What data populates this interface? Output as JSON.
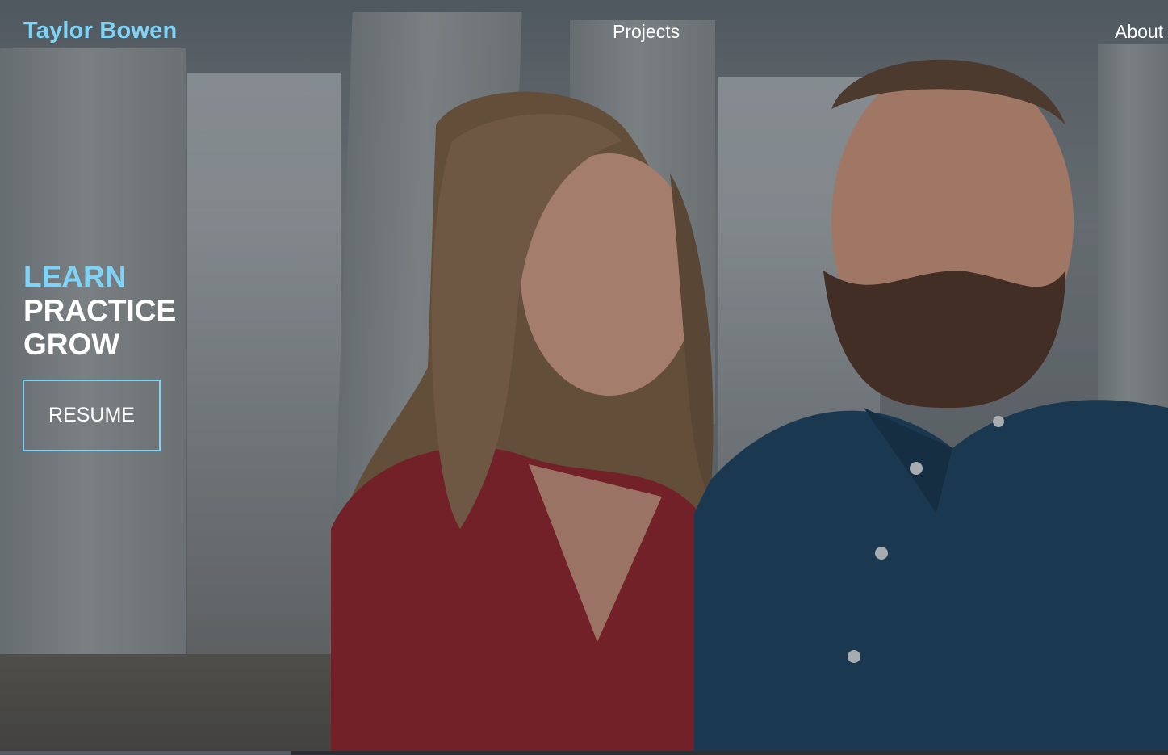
{
  "nav": {
    "brand": "Taylor Bowen",
    "links": [
      {
        "label": "Projects"
      },
      {
        "label": "About"
      }
    ]
  },
  "hero": {
    "slogan": [
      "LEARN",
      "PRACTICE",
      "GROW"
    ],
    "resume_button": "RESUME",
    "background_photo": "couple-portrait-fountain"
  },
  "colors": {
    "accent": "#7fd3f7",
    "text": "#ffffff"
  }
}
